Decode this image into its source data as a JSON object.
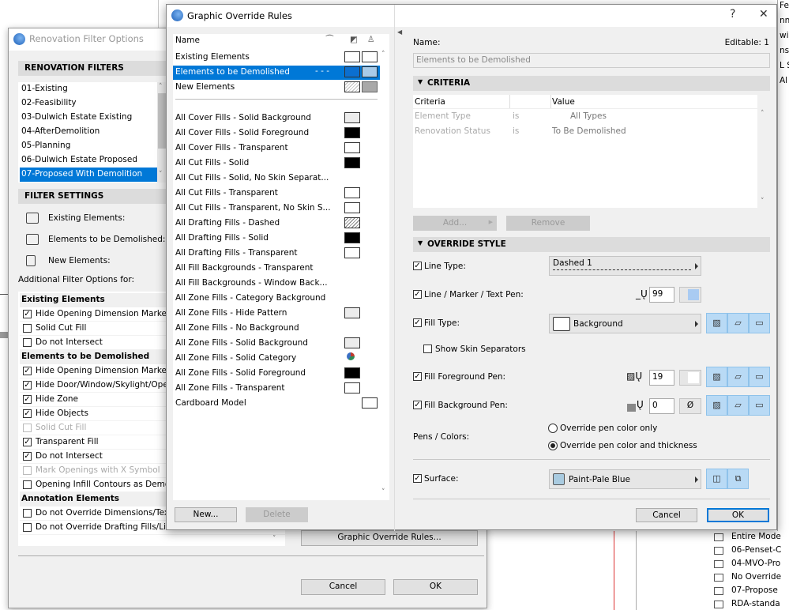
{
  "background": {
    "navigator_top": [
      "Feasil",
      "nn",
      "wi",
      "nst",
      "L S",
      "Al"
    ],
    "navigator_bottom": [
      "Entire Mode",
      "06-Penset-C",
      "04-MVO-Pro",
      "No Override",
      "07-Propose",
      "RDA-standa"
    ]
  },
  "renovation_dialog": {
    "title": "Renovation Filter Options",
    "filters_header": "RENOVATION FILTERS",
    "filters": [
      "01-Existing",
      "02-Feasibility",
      "03-Dulwich Estate Existing",
      "04-AfterDemolition",
      "05-Planning",
      "06-Dulwich Estate Proposed",
      "07-Proposed With Demolition"
    ],
    "selected_filter": "07-Proposed With Demolition",
    "settings_header": "FILTER SETTINGS",
    "existing_label": "Existing Elements:",
    "demolished_label": "Elements to be Demolished:",
    "new_label": "New Elements:",
    "additional_label": "Additional Filter Options for:",
    "groups": [
      {
        "title": "Existing Elements",
        "options": [
          {
            "label": "Hide Opening Dimension Marker",
            "checked": true,
            "enabled": true
          },
          {
            "label": "Solid Cut Fill",
            "checked": false,
            "enabled": true
          },
          {
            "label": "Do not Intersect",
            "checked": false,
            "enabled": true
          }
        ]
      },
      {
        "title": "Elements to be Demolished",
        "options": [
          {
            "label": "Hide Opening Dimension Marker",
            "checked": true,
            "enabled": true
          },
          {
            "label": "Hide Door/Window/Skylight/Openi",
            "checked": true,
            "enabled": true
          },
          {
            "label": "Hide Zone",
            "checked": true,
            "enabled": true
          },
          {
            "label": "Hide Objects",
            "checked": true,
            "enabled": true
          },
          {
            "label": "Solid Cut Fill",
            "checked": false,
            "enabled": false
          },
          {
            "label": "Transparent Fill",
            "checked": true,
            "enabled": true
          },
          {
            "label": "Do not Intersect",
            "checked": true,
            "enabled": true
          },
          {
            "label": "Mark Openings with X Symbol",
            "checked": false,
            "enabled": false
          },
          {
            "label": "Opening Infill Contours as Demolis",
            "checked": false,
            "enabled": true
          }
        ]
      },
      {
        "title": "Annotation Elements",
        "options": [
          {
            "label": "Do not Override Dimensions/Texts/L",
            "checked": false,
            "enabled": true
          },
          {
            "label": "Do not Override Drafting Fills/Lines",
            "checked": false,
            "enabled": true
          }
        ]
      }
    ],
    "gor_button": "Graphic Override Rules...",
    "cancel": "Cancel",
    "ok": "OK"
  },
  "gor_dialog": {
    "title": "Graphic Override Rules",
    "help": "?",
    "close": "✕",
    "list_header": "Name",
    "rules_top": [
      {
        "name": "Existing Elements",
        "line": "",
        "fill": "white",
        "surface": "white"
      },
      {
        "name": "Elements to be Demolished",
        "line": "- - -",
        "fill": "blue",
        "surface": "lightblue",
        "selected": true
      },
      {
        "name": "New Elements",
        "line": "",
        "fill": "hatchlight",
        "surface": "gray"
      }
    ],
    "rules": [
      {
        "name": "All Cover Fills - Solid Background",
        "fill": "light"
      },
      {
        "name": "All Cover Fills - Solid Foreground",
        "fill": "black"
      },
      {
        "name": "All Cover Fills - Transparent",
        "fill": "white"
      },
      {
        "name": "All Cut Fills - Solid",
        "fill": "black"
      },
      {
        "name": "All Cut Fills - Solid, No Skin Separat...",
        "fill": ""
      },
      {
        "name": "All Cut Fills - Transparent",
        "fill": "white"
      },
      {
        "name": "All Cut Fills - Transparent, No Skin S...",
        "fill": "white"
      },
      {
        "name": "All Drafting Fills - Dashed",
        "fill": "hatch"
      },
      {
        "name": "All Drafting Fills - Solid",
        "fill": "black"
      },
      {
        "name": "All Drafting Fills - Transparent",
        "fill": "white"
      },
      {
        "name": "All Fill Backgrounds - Transparent",
        "fill": ""
      },
      {
        "name": "All Fill Backgrounds - Window Back...",
        "fill": ""
      },
      {
        "name": "All Zone Fills - Category Background",
        "fill": ""
      },
      {
        "name": "All Zone Fills - Hide Pattern",
        "fill": "light"
      },
      {
        "name": "All Zone Fills - No Background",
        "fill": ""
      },
      {
        "name": "All Zone Fills - Solid Background",
        "fill": "light"
      },
      {
        "name": "All Zone Fills - Solid Category",
        "fill": "zonecat"
      },
      {
        "name": "All Zone Fills - Solid Foreground",
        "fill": "black"
      },
      {
        "name": "All Zone Fills - Transparent",
        "fill": "white"
      },
      {
        "name": "Cardboard Model",
        "surface": "white"
      }
    ],
    "new_button": "New...",
    "delete_button": "Delete",
    "name_label": "Name:",
    "editable": "Editable: 1",
    "name_value": "Elements to be Demolished",
    "criteria_header": "CRITERIA",
    "criteria_cols": [
      "Criteria",
      "Value"
    ],
    "criteria_rows": [
      {
        "criteria": "Element Type",
        "op": "is",
        "value": "All Types"
      },
      {
        "criteria": "Renovation Status",
        "op": "is",
        "value": "To Be Demolished"
      }
    ],
    "add_button": "Add...",
    "remove_button": "Remove",
    "override_header": "OVERRIDE STYLE",
    "line_type": {
      "label": "Line Type:",
      "checked": true,
      "value": "Dashed 1"
    },
    "line_pen": {
      "label": "Line / Marker / Text Pen:",
      "checked": true,
      "value": "99",
      "color": "#a9cbf2"
    },
    "fill_type": {
      "label": "Fill Type:",
      "checked": true,
      "value": "Background"
    },
    "skin_separators": {
      "label": "Show Skin Separators",
      "checked": false
    },
    "fill_fg_pen": {
      "label": "Fill Foreground Pen:",
      "checked": true,
      "value": "19",
      "color": "#ffffff"
    },
    "fill_bg_pen": {
      "label": "Fill Background Pen:",
      "checked": true,
      "value": "0",
      "color_symbol": "Ø"
    },
    "pens_colors": {
      "label": "Pens / Colors:",
      "options": [
        "Override pen color only",
        "Override pen color and thickness"
      ],
      "selected": 1
    },
    "surface": {
      "label": "Surface:",
      "checked": true,
      "value": "Paint-Pale Blue",
      "color": "#a9cbe0"
    },
    "cancel": "Cancel",
    "ok": "OK"
  }
}
